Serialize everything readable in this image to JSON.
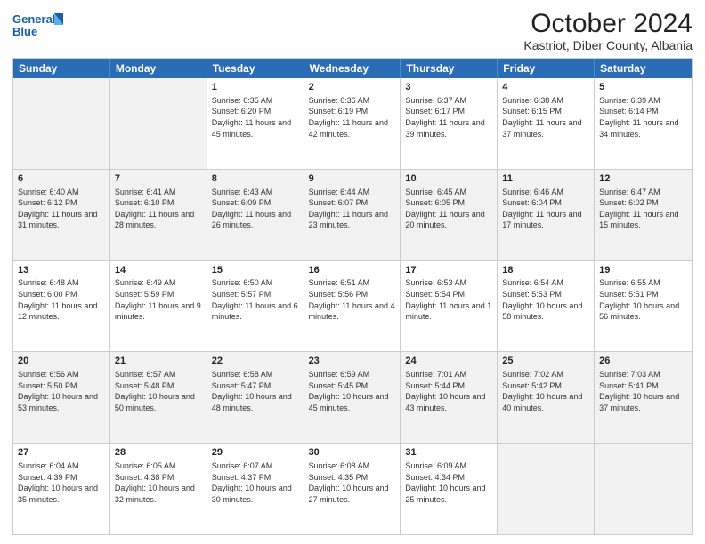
{
  "header": {
    "logo_line1": "General",
    "logo_line2": "Blue",
    "month": "October 2024",
    "location": "Kastriot, Diber County, Albania"
  },
  "days": [
    "Sunday",
    "Monday",
    "Tuesday",
    "Wednesday",
    "Thursday",
    "Friday",
    "Saturday"
  ],
  "weeks": [
    [
      {
        "day": "",
        "info": ""
      },
      {
        "day": "",
        "info": ""
      },
      {
        "day": "1",
        "info": "Sunrise: 6:35 AM\nSunset: 6:20 PM\nDaylight: 11 hours and 45 minutes."
      },
      {
        "day": "2",
        "info": "Sunrise: 6:36 AM\nSunset: 6:19 PM\nDaylight: 11 hours and 42 minutes."
      },
      {
        "day": "3",
        "info": "Sunrise: 6:37 AM\nSunset: 6:17 PM\nDaylight: 11 hours and 39 minutes."
      },
      {
        "day": "4",
        "info": "Sunrise: 6:38 AM\nSunset: 6:15 PM\nDaylight: 11 hours and 37 minutes."
      },
      {
        "day": "5",
        "info": "Sunrise: 6:39 AM\nSunset: 6:14 PM\nDaylight: 11 hours and 34 minutes."
      }
    ],
    [
      {
        "day": "6",
        "info": "Sunrise: 6:40 AM\nSunset: 6:12 PM\nDaylight: 11 hours and 31 minutes."
      },
      {
        "day": "7",
        "info": "Sunrise: 6:41 AM\nSunset: 6:10 PM\nDaylight: 11 hours and 28 minutes."
      },
      {
        "day": "8",
        "info": "Sunrise: 6:43 AM\nSunset: 6:09 PM\nDaylight: 11 hours and 26 minutes."
      },
      {
        "day": "9",
        "info": "Sunrise: 6:44 AM\nSunset: 6:07 PM\nDaylight: 11 hours and 23 minutes."
      },
      {
        "day": "10",
        "info": "Sunrise: 6:45 AM\nSunset: 6:05 PM\nDaylight: 11 hours and 20 minutes."
      },
      {
        "day": "11",
        "info": "Sunrise: 6:46 AM\nSunset: 6:04 PM\nDaylight: 11 hours and 17 minutes."
      },
      {
        "day": "12",
        "info": "Sunrise: 6:47 AM\nSunset: 6:02 PM\nDaylight: 11 hours and 15 minutes."
      }
    ],
    [
      {
        "day": "13",
        "info": "Sunrise: 6:48 AM\nSunset: 6:00 PM\nDaylight: 11 hours and 12 minutes."
      },
      {
        "day": "14",
        "info": "Sunrise: 6:49 AM\nSunset: 5:59 PM\nDaylight: 11 hours and 9 minutes."
      },
      {
        "day": "15",
        "info": "Sunrise: 6:50 AM\nSunset: 5:57 PM\nDaylight: 11 hours and 6 minutes."
      },
      {
        "day": "16",
        "info": "Sunrise: 6:51 AM\nSunset: 5:56 PM\nDaylight: 11 hours and 4 minutes."
      },
      {
        "day": "17",
        "info": "Sunrise: 6:53 AM\nSunset: 5:54 PM\nDaylight: 11 hours and 1 minute."
      },
      {
        "day": "18",
        "info": "Sunrise: 6:54 AM\nSunset: 5:53 PM\nDaylight: 10 hours and 58 minutes."
      },
      {
        "day": "19",
        "info": "Sunrise: 6:55 AM\nSunset: 5:51 PM\nDaylight: 10 hours and 56 minutes."
      }
    ],
    [
      {
        "day": "20",
        "info": "Sunrise: 6:56 AM\nSunset: 5:50 PM\nDaylight: 10 hours and 53 minutes."
      },
      {
        "day": "21",
        "info": "Sunrise: 6:57 AM\nSunset: 5:48 PM\nDaylight: 10 hours and 50 minutes."
      },
      {
        "day": "22",
        "info": "Sunrise: 6:58 AM\nSunset: 5:47 PM\nDaylight: 10 hours and 48 minutes."
      },
      {
        "day": "23",
        "info": "Sunrise: 6:59 AM\nSunset: 5:45 PM\nDaylight: 10 hours and 45 minutes."
      },
      {
        "day": "24",
        "info": "Sunrise: 7:01 AM\nSunset: 5:44 PM\nDaylight: 10 hours and 43 minutes."
      },
      {
        "day": "25",
        "info": "Sunrise: 7:02 AM\nSunset: 5:42 PM\nDaylight: 10 hours and 40 minutes."
      },
      {
        "day": "26",
        "info": "Sunrise: 7:03 AM\nSunset: 5:41 PM\nDaylight: 10 hours and 37 minutes."
      }
    ],
    [
      {
        "day": "27",
        "info": "Sunrise: 6:04 AM\nSunset: 4:39 PM\nDaylight: 10 hours and 35 minutes."
      },
      {
        "day": "28",
        "info": "Sunrise: 6:05 AM\nSunset: 4:38 PM\nDaylight: 10 hours and 32 minutes."
      },
      {
        "day": "29",
        "info": "Sunrise: 6:07 AM\nSunset: 4:37 PM\nDaylight: 10 hours and 30 minutes."
      },
      {
        "day": "30",
        "info": "Sunrise: 6:08 AM\nSunset: 4:35 PM\nDaylight: 10 hours and 27 minutes."
      },
      {
        "day": "31",
        "info": "Sunrise: 6:09 AM\nSunset: 4:34 PM\nDaylight: 10 hours and 25 minutes."
      },
      {
        "day": "",
        "info": ""
      },
      {
        "day": "",
        "info": ""
      }
    ]
  ],
  "shaded_rows": [
    1,
    3
  ],
  "shaded_cells_row0": [
    0,
    1
  ],
  "shaded_cells_row4": [
    5,
    6
  ]
}
